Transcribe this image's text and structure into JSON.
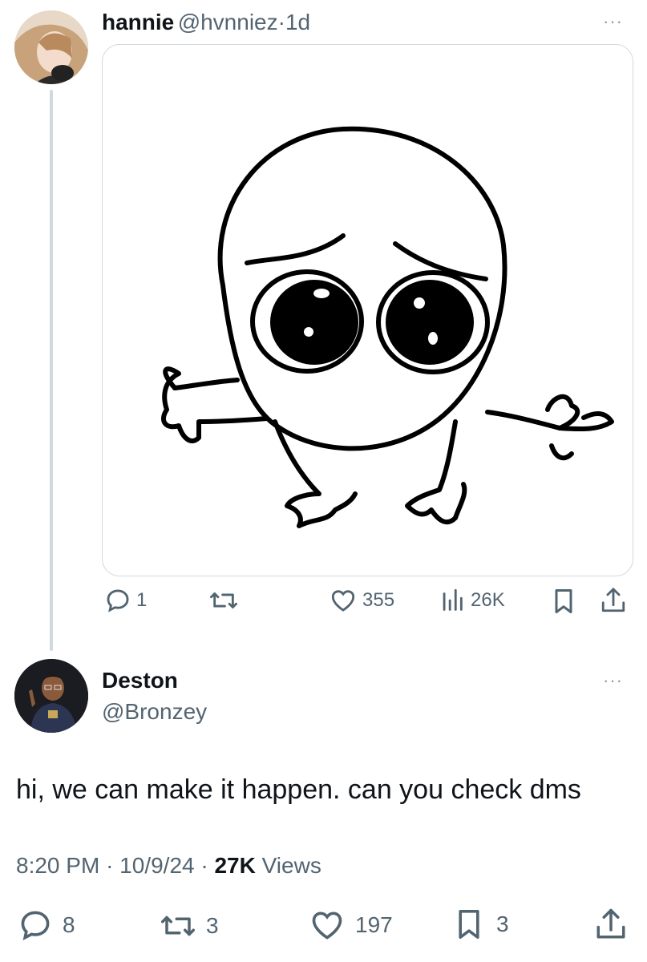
{
  "tweet": {
    "author_name": "hannie",
    "author_handle": "@hvnniez",
    "separator": "·",
    "time": "1d",
    "more": "···",
    "actions": {
      "reply_count": "1",
      "retweet_count": "",
      "like_count": "355",
      "views_count": "26K"
    },
    "icons": [
      "reply-icon",
      "retweet-icon",
      "heart-icon",
      "views-icon",
      "bookmark-icon",
      "share-icon"
    ]
  },
  "reply": {
    "author_name": "Deston",
    "author_handle": "@Bronzey",
    "more": "···",
    "text": "hi, we can make it happen. can you check dms",
    "time": "8:20 PM",
    "sep1": "·",
    "date": "10/9/24",
    "sep2": "·",
    "views": "27K",
    "views_label": "Views",
    "actions": {
      "reply_count": "8",
      "retweet_count": "3",
      "like_count": "197",
      "bookmark_count": "3"
    }
  },
  "colors": {
    "text_primary": "#0f1419",
    "text_secondary": "#536471",
    "border": "#cfd9de"
  }
}
